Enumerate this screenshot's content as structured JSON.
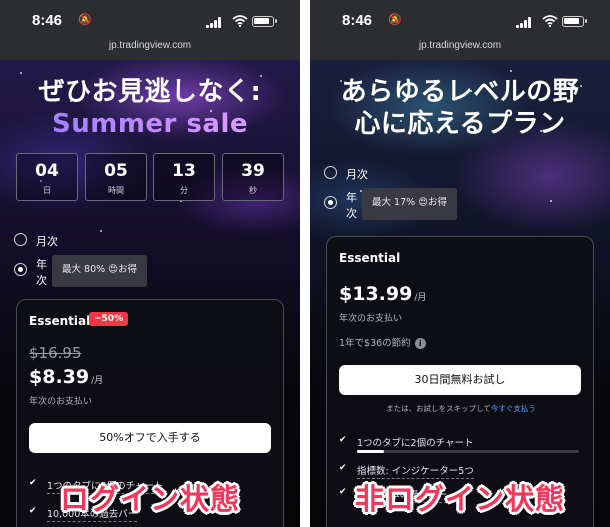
{
  "status_bar": {
    "time": "8:46"
  },
  "url": "jp.tradingview.com",
  "left": {
    "headline_line1": "ぜひお見逃しなく:",
    "headline_line2": "Summer sale",
    "countdown": [
      {
        "value": "04",
        "unit": "日"
      },
      {
        "value": "05",
        "unit": "時間"
      },
      {
        "value": "13",
        "unit": "分"
      },
      {
        "value": "39",
        "unit": "秒"
      }
    ],
    "monthly_label": "月次",
    "annual_label": "年次",
    "discount_pill": "最大 80% 😍お得",
    "plan": {
      "name": "Essential",
      "badge": "−50%",
      "old_price": "$16.95",
      "price": "$8.39",
      "per": "/月",
      "billing": "年次のお支払い",
      "cta": "50%オフで入手する"
    },
    "feature_text": "1つのタブに2個のチャート",
    "feature_text_2": "10,000本の過去バー",
    "overlay_label": "ログイン状態"
  },
  "right": {
    "headline_line1": "あらゆるレベルの野",
    "headline_line2": "心に応えるプラン",
    "monthly_label": "月次",
    "annual_label": "年次",
    "discount_pill": "最大 17% 😍お得",
    "plan": {
      "name": "Essential",
      "price": "$13.99",
      "per": "/月",
      "billing": "年次のお支払い",
      "savings": "1年で$36の節約",
      "cta": "30日間無料お試し",
      "skip_text": "または、お試しをスキップして",
      "skip_link": "今すぐ支払う"
    },
    "features": [
      {
        "text": "1つのタブに2個のチャート",
        "progress": 0.12
      },
      {
        "text": "指標数: インジケーター5つ",
        "progress": 0.0
      },
      {
        "text": "10,000本の過去バー",
        "progress": 0.0
      }
    ],
    "overlay_label": "非ログイン状態"
  },
  "icons": {
    "mute": "bell-slash-icon",
    "signal": "signal-icon",
    "wifi": "wifi-icon",
    "battery": "battery-icon",
    "info": "info-icon",
    "check": "check-icon"
  },
  "colors": {
    "badge_red": "#f23645",
    "overlay_pink": "#f2375a",
    "link_blue": "#5b9cff"
  }
}
